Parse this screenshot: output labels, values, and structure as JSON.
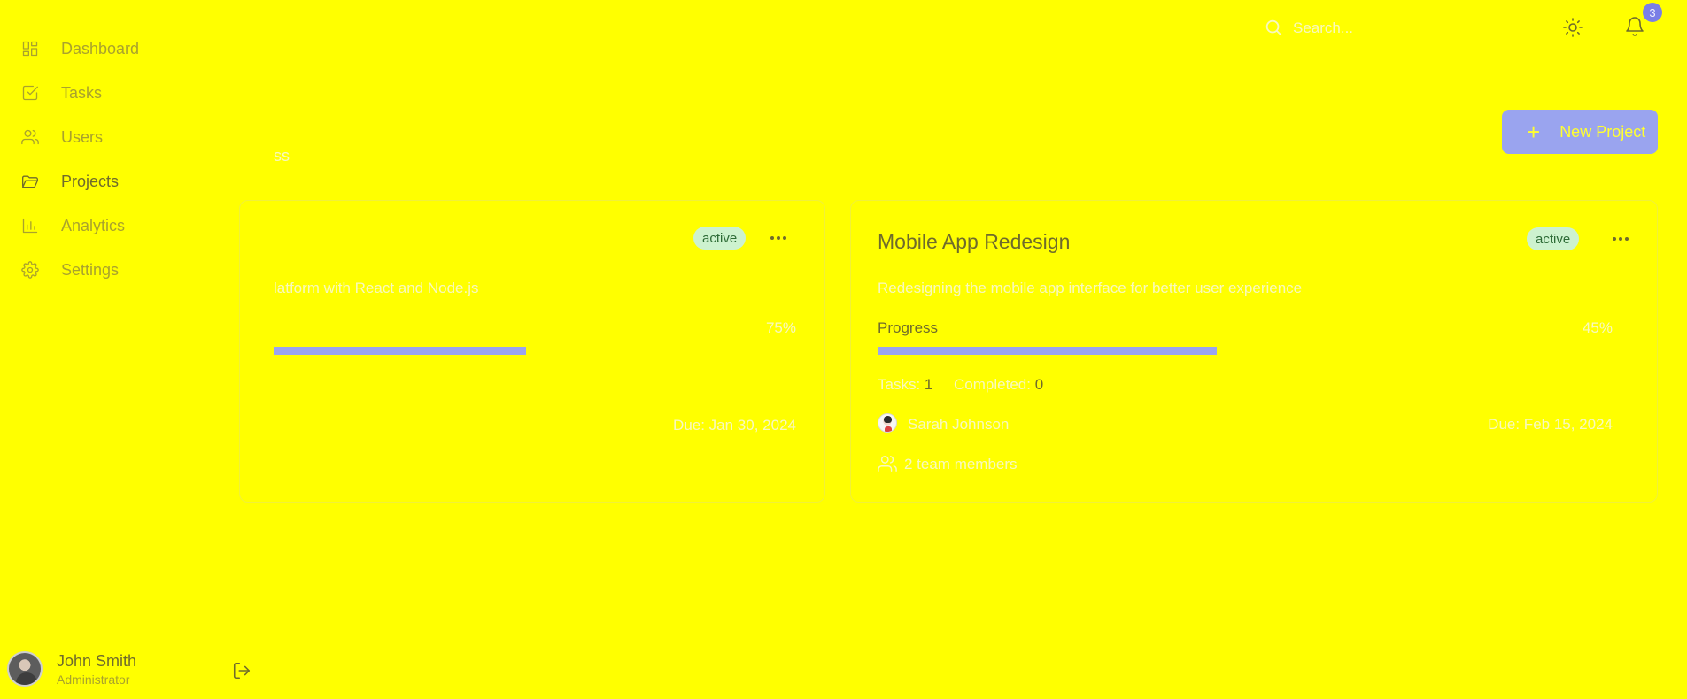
{
  "sidebar": {
    "items": [
      {
        "label": "Dashboard",
        "icon": "dashboard-icon"
      },
      {
        "label": "Tasks",
        "icon": "tasks-icon"
      },
      {
        "label": "Users",
        "icon": "users-icon"
      },
      {
        "label": "Projects",
        "icon": "folder-icon"
      },
      {
        "label": "Analytics",
        "icon": "analytics-icon"
      },
      {
        "label": "Settings",
        "icon": "settings-icon"
      }
    ],
    "user": {
      "name": "John Smith",
      "role": "Administrator"
    }
  },
  "header": {
    "search_placeholder": "Search...",
    "notification_count": "3"
  },
  "page": {
    "subtitle_fragment": "ss",
    "new_project_label": "New Project"
  },
  "projects": [
    {
      "status": "active",
      "description_fragment": "latform with React and Node.js",
      "progress_pct": "75%",
      "progress": 0.75,
      "due": "Due: Jan 30, 2024"
    },
    {
      "title": "Mobile App Redesign",
      "status": "active",
      "description": "Redesigning the mobile app interface for better user experience",
      "progress_label": "Progress",
      "progress_pct": "45%",
      "progress": 0.45,
      "tasks_label": "Tasks:",
      "tasks_count": "1",
      "completed_label": "Completed:",
      "completed_count": "0",
      "owner": "Sarah Johnson",
      "due": "Due: Feb 15, 2024",
      "team": "2 team members"
    }
  ],
  "colors": {
    "background": "#ffff00",
    "accent": "#9aa4ef",
    "badge": "#7a7fe6"
  }
}
